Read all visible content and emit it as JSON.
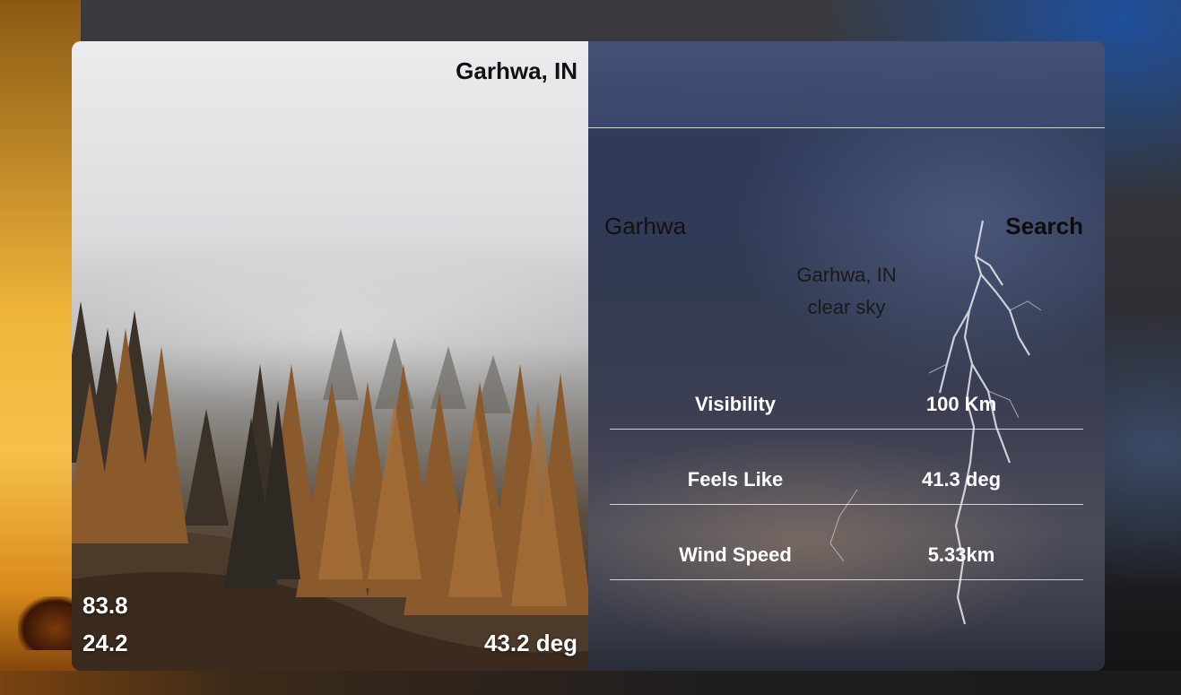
{
  "photo_panel": {
    "city_country": "Garhwa, IN",
    "humidity": "83.8",
    "pressure_or_secondary": "24.2",
    "temperature": "43.2 deg"
  },
  "search": {
    "input_value": "Garhwa",
    "button_label": "Search"
  },
  "location": {
    "name": "Garhwa, IN",
    "description": "clear sky"
  },
  "details": {
    "rows": [
      {
        "label": "Visibility",
        "value": "100 Km"
      },
      {
        "label": "Feels Like",
        "value": "41.3 deg"
      },
      {
        "label": "Wind Speed",
        "value": "5.33km"
      }
    ]
  },
  "colors": {
    "glass_panel": "#343b52",
    "divider": "#ffffff",
    "sunset_orange": "#f0b43a"
  }
}
